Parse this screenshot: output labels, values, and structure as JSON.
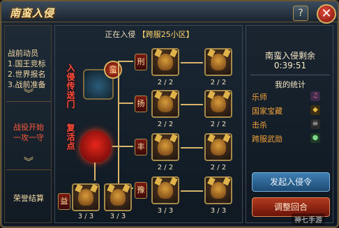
{
  "window": {
    "title": "南蛮入侵",
    "help_label": "?",
    "close_label": "✕"
  },
  "sidebar": {
    "section1_title": "战前动员",
    "section1_items": [
      "1.国王竞标",
      "2.世界报名",
      "3.战前准备"
    ],
    "section2_lines": [
      "战役开始",
      "一攻一守"
    ],
    "section3_title": "荣誉结算",
    "chevron": "︾"
  },
  "main": {
    "status_prefix": "正在入侵",
    "status_server": "【跨服25小区】",
    "left_label_1": "入侵传送门",
    "left_label_2": "复活点",
    "nodes": [
      {
        "badge": "刑",
        "counts": [
          "2 / 2",
          "2 / 2"
        ]
      },
      {
        "badge": "扬",
        "counts": [
          "2 / 2",
          "2 / 2"
        ]
      },
      {
        "badge": "丰",
        "counts": [
          "2 / 2",
          "2 / 2"
        ]
      },
      {
        "badge": "豫",
        "counts": [
          "3 / 3",
          "3 / 3"
        ]
      }
    ],
    "bottom_left": {
      "badge": "益",
      "counts": [
        "3 / 3",
        "3 / 3"
      ]
    },
    "portal_flag": "蛮"
  },
  "right": {
    "title": "南蛮入侵剩余",
    "timer": "0:39:51",
    "stats_title": "我的统计",
    "stats": [
      {
        "label": "乐师",
        "icon": "drum-icon"
      },
      {
        "label": "国家宝藏",
        "icon": "treasure-icon"
      },
      {
        "label": "击杀",
        "icon": "skull-icon"
      },
      {
        "label": "跨服武勋",
        "icon": "medal-icon"
      }
    ],
    "btn_invade": "发起入侵令",
    "btn_return": "调整回合"
  },
  "watermark": "神七手游"
}
